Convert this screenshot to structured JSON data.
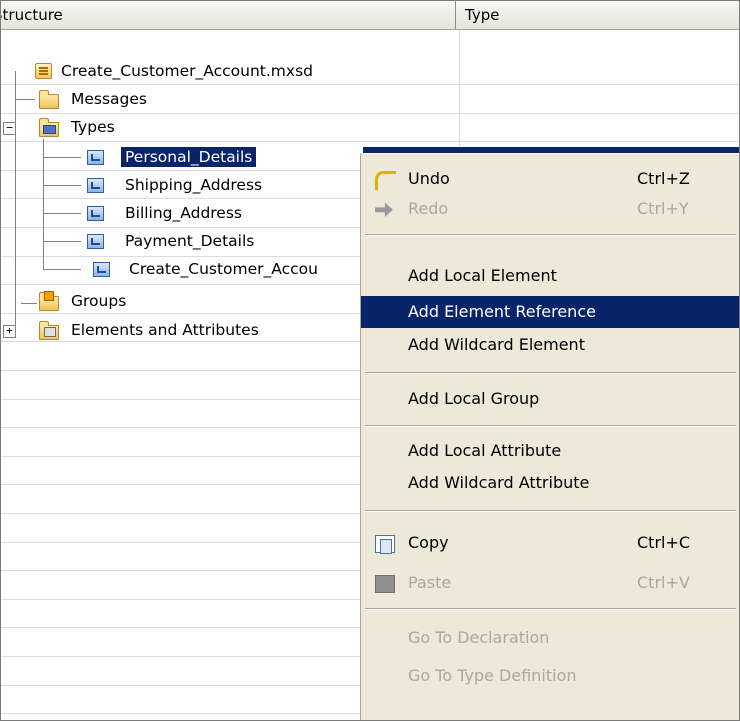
{
  "header": {
    "structure": "Structure",
    "type": "Type"
  },
  "tree": {
    "root": "Create_Customer_Account.mxsd",
    "messages": "Messages",
    "types": "Types",
    "type_items": [
      "Personal_Details",
      "Shipping_Address",
      "Billing_Address",
      "Payment_Details",
      "Create_Customer_Accou"
    ],
    "groups": "Groups",
    "elements": "Elements and Attributes",
    "expand_minus": "−",
    "expand_plus": "+"
  },
  "menu": {
    "undo": {
      "label": "Undo",
      "shortcut": "Ctrl+Z"
    },
    "redo": {
      "label": "Redo",
      "shortcut": "Ctrl+Y"
    },
    "add_local_element": "Add Local Element",
    "add_element_reference": "Add Element Reference",
    "add_wildcard_element": "Add Wildcard Element",
    "add_local_group": "Add Local Group",
    "add_local_attribute": "Add Local Attribute",
    "add_wildcard_attribute": "Add Wildcard Attribute",
    "copy": {
      "label": "Copy",
      "shortcut": "Ctrl+C"
    },
    "paste": {
      "label": "Paste",
      "shortcut": "Ctrl+V"
    },
    "go_to_declaration": "Go To Declaration",
    "go_to_type_definition": "Go To Type Definition"
  },
  "colors": {
    "selection": "#0a246a",
    "menu_bg": "#ece9d8",
    "disabled": "#aca899"
  }
}
